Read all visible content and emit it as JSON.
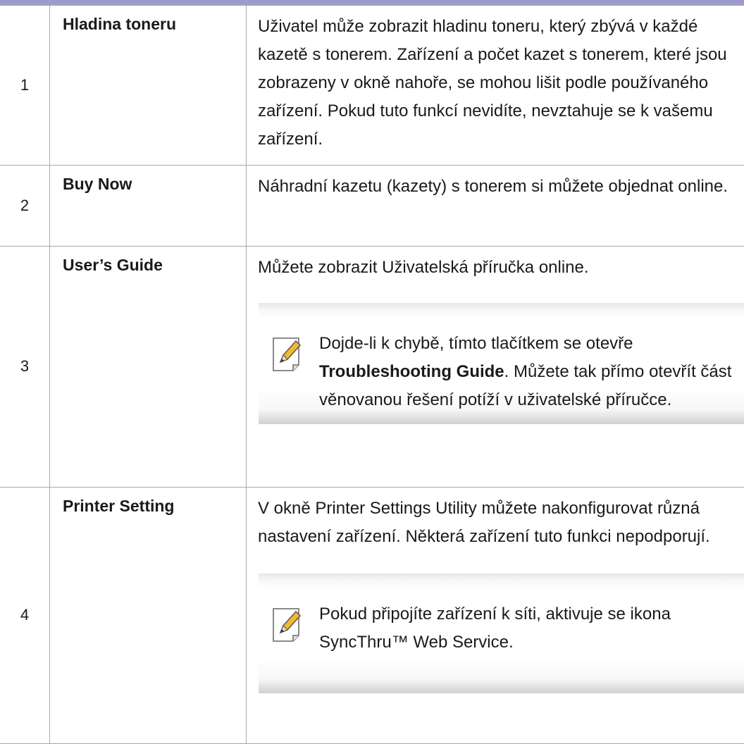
{
  "rows": [
    {
      "number": "1",
      "feature": "Hladina toneru",
      "description": "Uživatel může zobrazit hladinu toneru, který zbývá v každé kazetě s tonerem. Zařízení a počet kazet s tonerem, které jsou zobrazeny v okně nahoře, se mohou lišit podle používaného zařízení. Pokud tuto funkcí nevidíte, nevztahuje se k vašemu zařízení."
    },
    {
      "number": "2",
      "feature": "Buy Now",
      "description": "Náhradní kazetu (kazety) s tonerem si můžete objednat online."
    },
    {
      "number": "3",
      "feature": "User’s Guide",
      "description": "Můžete zobrazit Uživatelská příručka online.",
      "note": {
        "icon": "note-pencil-icon",
        "text_before": "Dojde-li k chybě, tímto tlačítkem se otevře ",
        "text_bold": "Troubleshooting Guide",
        "text_after": ". Můžete tak přímo otevřít část věnovanou řešení potíží v uživatelské příručce."
      }
    },
    {
      "number": "4",
      "feature": "Printer Setting",
      "description": "V okně Printer Settings Utility můžete nakonfigurovat různá nastavení zařízení. Některá zařízení tuto funkci nepodporují.",
      "note": {
        "icon": "note-pencil-icon",
        "text": "Pokud připojíte zařízení k síti, aktivuje se ikona SyncThru™ Web Service."
      }
    }
  ],
  "colors": {
    "top_rule": "#9c9ccc",
    "border": "#a8a8a8",
    "text": "#1a1a1a",
    "note_icon_accent": "#f2b82e"
  }
}
